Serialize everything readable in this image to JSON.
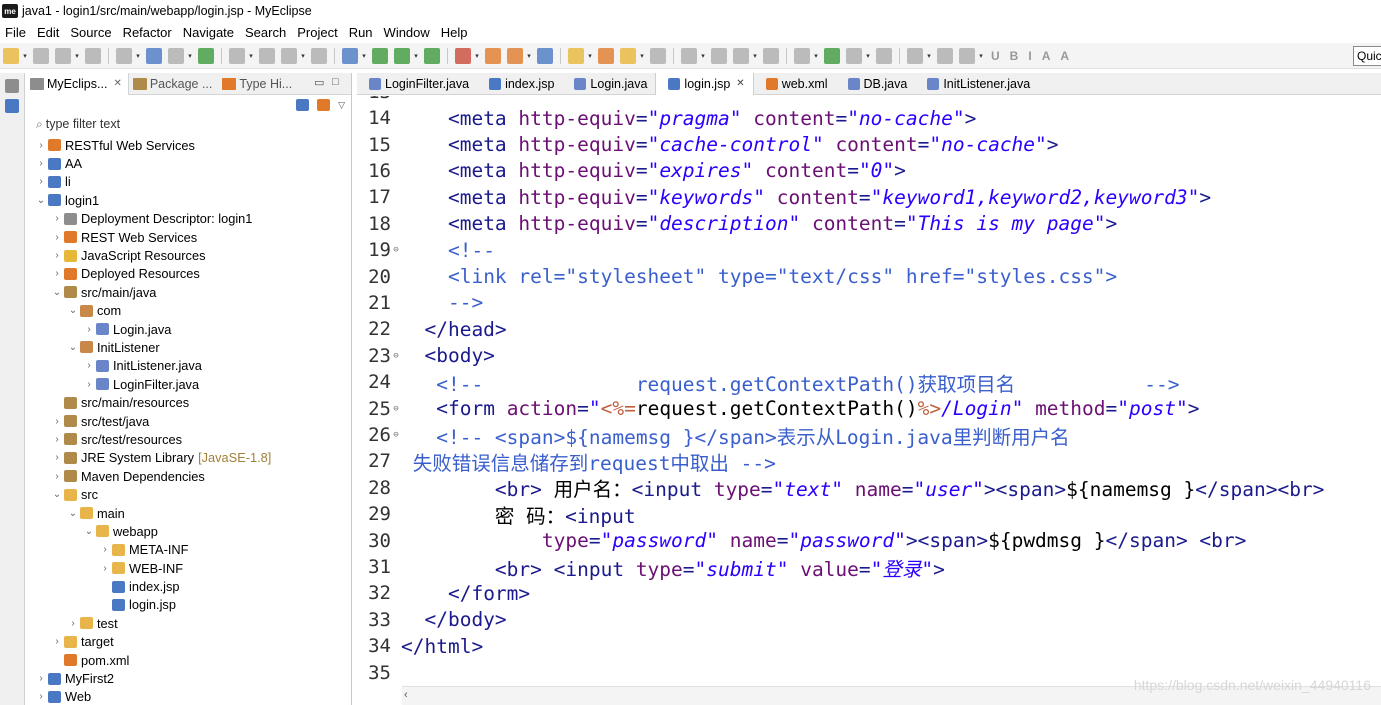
{
  "window": {
    "title": "java1 - login1/src/main/webapp/login.jsp - MyEclipse",
    "icon_label": "me"
  },
  "menu": [
    "File",
    "Edit",
    "Source",
    "Refactor",
    "Navigate",
    "Search",
    "Project",
    "Run",
    "Window",
    "Help"
  ],
  "toolbar": {
    "quick_access_text": "Quic"
  },
  "explorer": {
    "tabs": [
      {
        "label": "MyEclips...",
        "active": true
      },
      {
        "label": "Package ...",
        "active": false
      },
      {
        "label": "Type Hi...",
        "active": false
      }
    ],
    "filter_placeholder": "type filter text",
    "tree": [
      {
        "depth": 0,
        "arrow": ">",
        "label": "RESTful Web Services",
        "icon": "rest-icon"
      },
      {
        "depth": 0,
        "arrow": ">",
        "label": "AA",
        "icon": "project-icon"
      },
      {
        "depth": 0,
        "arrow": ">",
        "label": "li",
        "icon": "project-icon"
      },
      {
        "depth": 0,
        "arrow": "v",
        "label": "login1",
        "icon": "project-icon"
      },
      {
        "depth": 1,
        "arrow": ">",
        "label": "Deployment Descriptor: login1",
        "icon": "descriptor-icon"
      },
      {
        "depth": 1,
        "arrow": ">",
        "label": "REST Web Services",
        "icon": "rest-icon"
      },
      {
        "depth": 1,
        "arrow": ">",
        "label": "JavaScript Resources",
        "icon": "js-icon"
      },
      {
        "depth": 1,
        "arrow": ">",
        "label": "Deployed Resources",
        "icon": "deployed-icon"
      },
      {
        "depth": 1,
        "arrow": "v",
        "label": "src/main/java",
        "icon": "source-folder-icon"
      },
      {
        "depth": 2,
        "arrow": "v",
        "label": "com",
        "icon": "package-icon"
      },
      {
        "depth": 3,
        "arrow": ">",
        "label": "Login.java",
        "icon": "java-file-icon"
      },
      {
        "depth": 2,
        "arrow": "v",
        "label": "InitListener",
        "icon": "package-icon"
      },
      {
        "depth": 3,
        "arrow": ">",
        "label": "InitListener.java",
        "icon": "java-file-icon"
      },
      {
        "depth": 3,
        "arrow": ">",
        "label": "LoginFilter.java",
        "icon": "java-file-icon"
      },
      {
        "depth": 1,
        "arrow": "",
        "label": "src/main/resources",
        "icon": "source-folder-icon"
      },
      {
        "depth": 1,
        "arrow": ">",
        "label": "src/test/java",
        "icon": "source-folder-icon"
      },
      {
        "depth": 1,
        "arrow": ">",
        "label": "src/test/resources",
        "icon": "source-folder-icon"
      },
      {
        "depth": 1,
        "arrow": ">",
        "label": "JRE System Library",
        "icon": "library-icon",
        "decoration": "[JavaSE-1.8]"
      },
      {
        "depth": 1,
        "arrow": ">",
        "label": "Maven Dependencies",
        "icon": "library-icon"
      },
      {
        "depth": 1,
        "arrow": "v",
        "label": "src",
        "icon": "folder-icon"
      },
      {
        "depth": 2,
        "arrow": "v",
        "label": "main",
        "icon": "folder-icon"
      },
      {
        "depth": 3,
        "arrow": "v",
        "label": "webapp",
        "icon": "folder-icon"
      },
      {
        "depth": 4,
        "arrow": ">",
        "label": "META-INF",
        "icon": "folder-icon"
      },
      {
        "depth": 4,
        "arrow": ">",
        "label": "WEB-INF",
        "icon": "folder-icon"
      },
      {
        "depth": 4,
        "arrow": "",
        "label": "index.jsp",
        "icon": "jsp-file-icon"
      },
      {
        "depth": 4,
        "arrow": "",
        "label": "login.jsp",
        "icon": "jsp-file-icon"
      },
      {
        "depth": 2,
        "arrow": ">",
        "label": "test",
        "icon": "folder-icon"
      },
      {
        "depth": 1,
        "arrow": ">",
        "label": "target",
        "icon": "folder-icon"
      },
      {
        "depth": 1,
        "arrow": "",
        "label": "pom.xml",
        "icon": "xml-file-icon"
      },
      {
        "depth": 0,
        "arrow": ">",
        "label": "MyFirst2",
        "icon": "project-icon"
      },
      {
        "depth": 0,
        "arrow": ">",
        "label": "Web",
        "icon": "project-icon"
      }
    ]
  },
  "editor": {
    "tabs": [
      {
        "label": "LoginFilter.java",
        "active": false,
        "icon": "java-file-icon"
      },
      {
        "label": "index.jsp",
        "active": false,
        "icon": "jsp-file-icon"
      },
      {
        "label": "Login.java",
        "active": false,
        "icon": "java-file-icon"
      },
      {
        "label": "login.jsp",
        "active": true,
        "icon": "jsp-file-icon"
      },
      {
        "label": "web.xml",
        "active": false,
        "icon": "xml-file-icon"
      },
      {
        "label": "DB.java",
        "active": false,
        "icon": "java-file-icon"
      },
      {
        "label": "InitListener.java",
        "active": false,
        "icon": "java-file-icon"
      }
    ],
    "partial_top_line": "13",
    "lines": [
      {
        "num": "14",
        "fold": "",
        "indent": "    ",
        "segments": [
          [
            "t",
            "<meta "
          ],
          [
            "a",
            "http-equiv"
          ],
          [
            "t",
            "="
          ],
          [
            "s",
            "\"pragma\""
          ],
          [
            "t",
            " "
          ],
          [
            "a",
            "content"
          ],
          [
            "t",
            "="
          ],
          [
            "s",
            "\"no-cache\""
          ],
          [
            "t",
            ">"
          ]
        ]
      },
      {
        "num": "15",
        "fold": "",
        "indent": "    ",
        "segments": [
          [
            "t",
            "<meta "
          ],
          [
            "a",
            "http-equiv"
          ],
          [
            "t",
            "="
          ],
          [
            "s",
            "\"cache-control\""
          ],
          [
            "t",
            " "
          ],
          [
            "a",
            "content"
          ],
          [
            "t",
            "="
          ],
          [
            "s",
            "\"no-cache\""
          ],
          [
            "t",
            ">"
          ]
        ]
      },
      {
        "num": "16",
        "fold": "",
        "indent": "    ",
        "segments": [
          [
            "t",
            "<meta "
          ],
          [
            "a",
            "http-equiv"
          ],
          [
            "t",
            "="
          ],
          [
            "s",
            "\"expires\""
          ],
          [
            "t",
            " "
          ],
          [
            "a",
            "content"
          ],
          [
            "t",
            "="
          ],
          [
            "s",
            "\"0\""
          ],
          [
            "t",
            ">"
          ]
        ]
      },
      {
        "num": "17",
        "fold": "",
        "indent": "    ",
        "segments": [
          [
            "t",
            "<meta "
          ],
          [
            "a",
            "http-equiv"
          ],
          [
            "t",
            "="
          ],
          [
            "s",
            "\"keywords\""
          ],
          [
            "t",
            " "
          ],
          [
            "a",
            "content"
          ],
          [
            "t",
            "="
          ],
          [
            "s",
            "\"keyword1,keyword2,keyword3\""
          ],
          [
            "t",
            ">"
          ]
        ]
      },
      {
        "num": "18",
        "fold": "",
        "indent": "    ",
        "segments": [
          [
            "t",
            "<meta "
          ],
          [
            "a",
            "http-equiv"
          ],
          [
            "t",
            "="
          ],
          [
            "s",
            "\"description\""
          ],
          [
            "t",
            " "
          ],
          [
            "a",
            "content"
          ],
          [
            "t",
            "="
          ],
          [
            "s",
            "\"This is my page\""
          ],
          [
            "t",
            ">"
          ]
        ]
      },
      {
        "num": "19",
        "fold": "⊖",
        "indent": "    ",
        "segments": [
          [
            "c",
            "<!--"
          ]
        ]
      },
      {
        "num": "20",
        "fold": "",
        "indent": "    ",
        "segments": [
          [
            "c",
            "<link rel=\"stylesheet\" type=\"text/css\" href=\"styles.css\">"
          ]
        ]
      },
      {
        "num": "21",
        "fold": "",
        "indent": "    ",
        "segments": [
          [
            "c",
            "-->"
          ]
        ]
      },
      {
        "num": "22",
        "fold": "",
        "indent": "  ",
        "segments": [
          [
            "t",
            "</head>"
          ]
        ]
      },
      {
        "num": "23",
        "fold": "⊖",
        "indent": "  ",
        "segments": [
          [
            "t",
            "<body>"
          ]
        ]
      },
      {
        "num": "24",
        "fold": "",
        "indent": "   ",
        "segments": [
          [
            "c",
            "<!--             request.getContextPath()获取项目名           -->"
          ]
        ]
      },
      {
        "num": "25",
        "fold": "⊖",
        "indent": "   ",
        "segments": [
          [
            "t",
            "<form "
          ],
          [
            "a",
            "action"
          ],
          [
            "t",
            "="
          ],
          [
            "s",
            "\""
          ],
          [
            "jsp",
            "<%="
          ],
          [
            "txt",
            "request.getContextPath()"
          ],
          [
            "jsp",
            "%>"
          ],
          [
            "s",
            "/Login\""
          ],
          [
            "t",
            " "
          ],
          [
            "a",
            "method"
          ],
          [
            "t",
            "="
          ],
          [
            "s",
            "\"post\""
          ],
          [
            "t",
            ">"
          ]
        ]
      },
      {
        "num": "26",
        "fold": "⊖",
        "indent": "   ",
        "segments": [
          [
            "c",
            "<!-- <span>${namemsg }</span>表示从Login.java里判断用户名"
          ]
        ]
      },
      {
        "num": "27",
        "fold": "",
        "indent": " ",
        "segments": [
          [
            "c",
            "失败错误信息储存到request中取出 -->"
          ]
        ]
      },
      {
        "num": "28",
        "fold": "",
        "indent": "        ",
        "segments": [
          [
            "t",
            "<br>"
          ],
          [
            "txt",
            " 用户名："
          ],
          [
            "t",
            "<input "
          ],
          [
            "a",
            "type"
          ],
          [
            "t",
            "="
          ],
          [
            "s",
            "\"text\""
          ],
          [
            "t",
            " "
          ],
          [
            "a",
            "name"
          ],
          [
            "t",
            "="
          ],
          [
            "s",
            "\"user\""
          ],
          [
            "t",
            ">"
          ],
          [
            "t",
            "<span>"
          ],
          [
            "txt",
            "${namemsg }"
          ],
          [
            "t",
            "</span>"
          ],
          [
            "t",
            "<br>"
          ]
        ]
      },
      {
        "num": "29",
        "fold": "",
        "indent": "        ",
        "segments": [
          [
            "txt",
            "密 码："
          ],
          [
            "t",
            "<input"
          ]
        ]
      },
      {
        "num": "30",
        "fold": "",
        "indent": "            ",
        "segments": [
          [
            "a",
            "type"
          ],
          [
            "t",
            "="
          ],
          [
            "s",
            "\"password\""
          ],
          [
            "t",
            " "
          ],
          [
            "a",
            "name"
          ],
          [
            "t",
            "="
          ],
          [
            "s",
            "\"password\""
          ],
          [
            "t",
            ">"
          ],
          [
            "t",
            "<span>"
          ],
          [
            "txt",
            "${pwdmsg }"
          ],
          [
            "t",
            "</span>"
          ],
          [
            "t",
            " <br>"
          ]
        ]
      },
      {
        "num": "31",
        "fold": "",
        "indent": "        ",
        "segments": [
          [
            "t",
            "<br>"
          ],
          [
            "t",
            " <input "
          ],
          [
            "a",
            "type"
          ],
          [
            "t",
            "="
          ],
          [
            "s",
            "\"submit\""
          ],
          [
            "t",
            " "
          ],
          [
            "a",
            "value"
          ],
          [
            "t",
            "="
          ],
          [
            "s",
            "\"登录\""
          ],
          [
            "t",
            ">"
          ]
        ]
      },
      {
        "num": "32",
        "fold": "",
        "indent": "    ",
        "segments": [
          [
            "t",
            "</form>"
          ]
        ]
      },
      {
        "num": "33",
        "fold": "",
        "indent": "  ",
        "segments": [
          [
            "t",
            "</body>"
          ]
        ]
      },
      {
        "num": "34",
        "fold": "",
        "indent": "",
        "segments": [
          [
            "t",
            "</html>"
          ]
        ]
      },
      {
        "num": "35",
        "fold": "",
        "indent": "",
        "segments": []
      }
    ]
  },
  "watermark": "https://blog.csdn.net/weixin_44940116"
}
